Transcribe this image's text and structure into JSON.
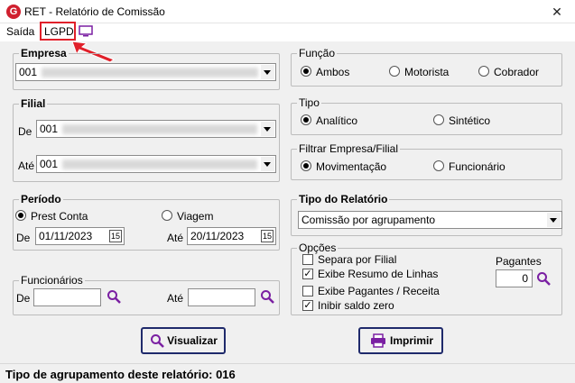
{
  "window": {
    "title": "RET - Relatório de Comissão",
    "close_label": "✕",
    "app_icon": "G"
  },
  "menu": {
    "saida": "Saída",
    "lgpd": "LGPD"
  },
  "empresa": {
    "legend": "Empresa",
    "value": "001"
  },
  "filial": {
    "legend": "Filial",
    "de_label": "De",
    "de_value": "001",
    "ate_label": "Até",
    "ate_value": "001"
  },
  "funcao": {
    "legend": "Função",
    "options": [
      "Ambos",
      "Motorista",
      "Cobrador"
    ],
    "selected": "Ambos"
  },
  "tipo": {
    "legend": "Tipo",
    "options": [
      "Analítico",
      "Sintético"
    ],
    "selected": "Analítico"
  },
  "filtrar": {
    "legend": "Filtrar Empresa/Filial",
    "options": [
      "Movimentação",
      "Funcionário"
    ],
    "selected": "Movimentação"
  },
  "periodo": {
    "legend": "Período",
    "options": [
      "Prest Conta",
      "Viagem"
    ],
    "selected": "Prest Conta",
    "de_label": "De",
    "de_value": "01/11/2023",
    "ate_label": "Até",
    "ate_value": "20/11/2023",
    "cal_label": "15"
  },
  "tipo_relatorio": {
    "legend": "Tipo do Relatório",
    "value": "Comissão por agrupamento"
  },
  "opcoes": {
    "legend": "Opções",
    "checks": [
      {
        "label": "Separa por Filial",
        "checked": false
      },
      {
        "label": "Exibe Resumo de Linhas",
        "checked": true
      },
      {
        "label": "Exibe Pagantes / Receita",
        "checked": false
      },
      {
        "label": "Inibir saldo zero",
        "checked": true
      }
    ],
    "pagantes_label": "Pagantes",
    "pagantes_value": "0"
  },
  "funcionarios": {
    "legend": "Funcionários",
    "de_label": "De",
    "ate_label": "Até"
  },
  "buttons": {
    "visualizar": "Visualizar",
    "imprimir": "Imprimir"
  },
  "status": "Tipo de agrupamento deste relatório: 016",
  "colors": {
    "highlight": "#e0202a",
    "accent": "#7a1fa2",
    "button_border": "#1f2a6b"
  }
}
